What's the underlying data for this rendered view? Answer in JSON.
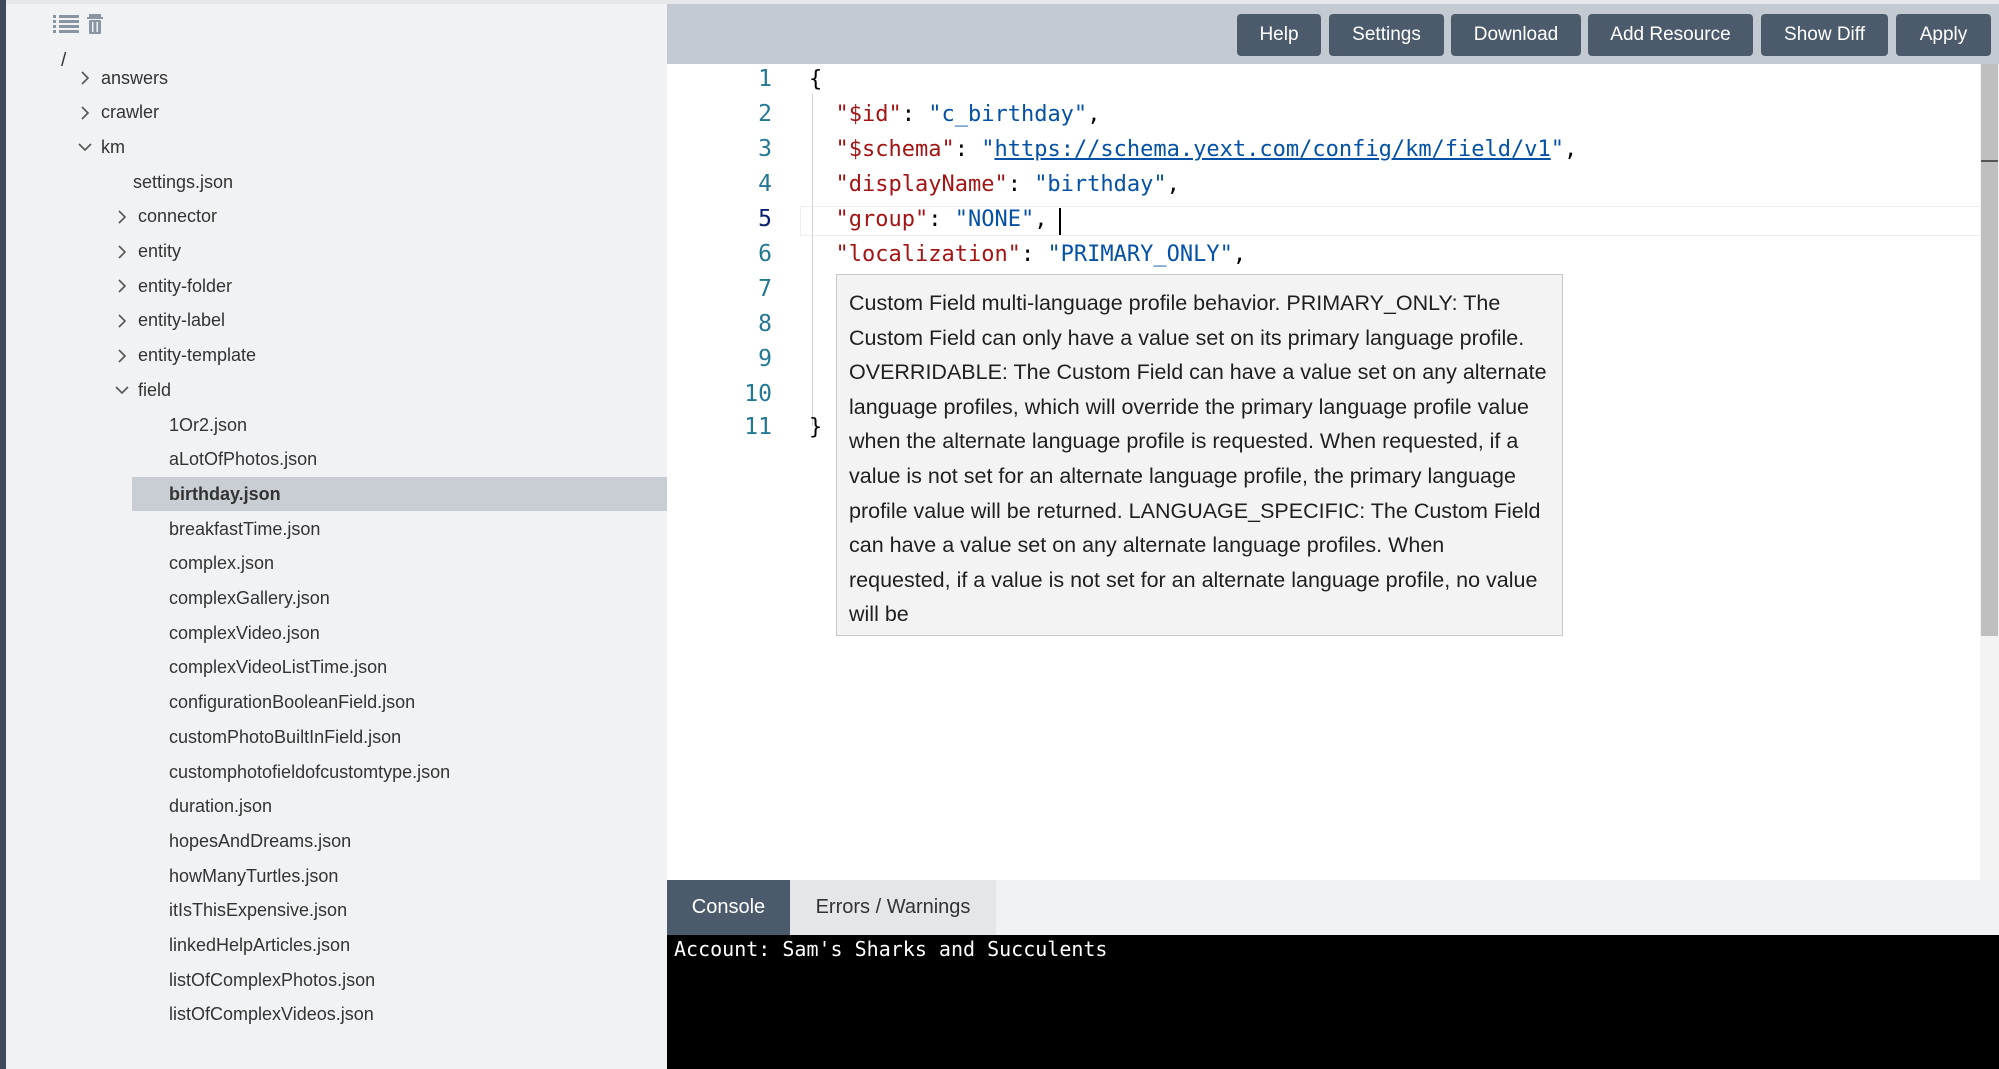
{
  "sidebar": {
    "root": "/",
    "tree": [
      {
        "label": "answers",
        "chevron": "right"
      },
      {
        "label": "crawler",
        "chevron": "right"
      },
      {
        "label": "km",
        "chevron": "down"
      },
      {
        "label": "settings.json",
        "chevron": "none"
      },
      {
        "label": "connector",
        "chevron": "right"
      },
      {
        "label": "entity",
        "chevron": "right"
      },
      {
        "label": "entity-folder",
        "chevron": "right"
      },
      {
        "label": "entity-label",
        "chevron": "right"
      },
      {
        "label": "entity-template",
        "chevron": "right"
      },
      {
        "label": "field",
        "chevron": "down"
      },
      {
        "label": "1Or2.json",
        "chevron": "none"
      },
      {
        "label": "aLotOfPhotos.json",
        "chevron": "none"
      },
      {
        "label": "birthday.json",
        "chevron": "none",
        "selected": true
      },
      {
        "label": "breakfastTime.json",
        "chevron": "none"
      },
      {
        "label": "complex.json",
        "chevron": "none"
      },
      {
        "label": "complexGallery.json",
        "chevron": "none"
      },
      {
        "label": "complexVideo.json",
        "chevron": "none"
      },
      {
        "label": "complexVideoListTime.json",
        "chevron": "none"
      },
      {
        "label": "configurationBooleanField.json",
        "chevron": "none"
      },
      {
        "label": "customPhotoBuiltInField.json",
        "chevron": "none"
      },
      {
        "label": "customphotofieldofcustomtype.json",
        "chevron": "none"
      },
      {
        "label": "duration.json",
        "chevron": "none"
      },
      {
        "label": "hopesAndDreams.json",
        "chevron": "none"
      },
      {
        "label": "howManyTurtles.json",
        "chevron": "none"
      },
      {
        "label": "itIsThisExpensive.json",
        "chevron": "none"
      },
      {
        "label": "linkedHelpArticles.json",
        "chevron": "none"
      },
      {
        "label": "listOfComplexPhotos.json",
        "chevron": "none"
      },
      {
        "label": "listOfComplexVideos.json",
        "chevron": "none"
      }
    ]
  },
  "toolbar": {
    "buttons": [
      "Help",
      "Settings",
      "Download",
      "Add Resource",
      "Show Diff",
      "Apply"
    ]
  },
  "editor": {
    "line_numbers": [
      "1",
      "2",
      "3",
      "4",
      "5",
      "6",
      "7",
      "8",
      "9",
      "10",
      "11"
    ],
    "active_line": "5",
    "lines": {
      "l1": "{",
      "l2_key": "\"$id\"",
      "l2_val": "\"c_birthday\"",
      "l3_key": "\"$schema\"",
      "l3_q1": "\"",
      "l3_url": "https://schema.yext.com/config/km/field/v1",
      "l3_q2": "\"",
      "l4_key": "\"displayName\"",
      "l4_val": "\"birthday\"",
      "l5_key": "\"group\"",
      "l5_val": "\"NONE\"",
      "l6_key": "\"localization\"",
      "l6_val": "\"PRIMARY_ONLY\"",
      "l11": "}",
      "colon": ": ",
      "comma": ","
    },
    "hover_text": "Custom Field multi-language profile behavior. PRIMARY_ONLY: The Custom Field can only have a value set on its primary language profile. OVERRIDABLE: The Custom Field can have a value set on any alternate language profiles, which will override the primary language profile value when the alternate language profile is requested. When requested, if a value is not set for an alternate language profile, the primary language profile value will be returned. LANGUAGE_SPECIFIC: The Custom Field can have a value set on any alternate language profiles. When requested, if a value is not set for an alternate language profile, no value will be"
  },
  "console": {
    "tabs": [
      "Console",
      "Errors / Warnings"
    ],
    "active_tab": "Console",
    "output": "Account: Sam's Sharks and Succulents"
  }
}
